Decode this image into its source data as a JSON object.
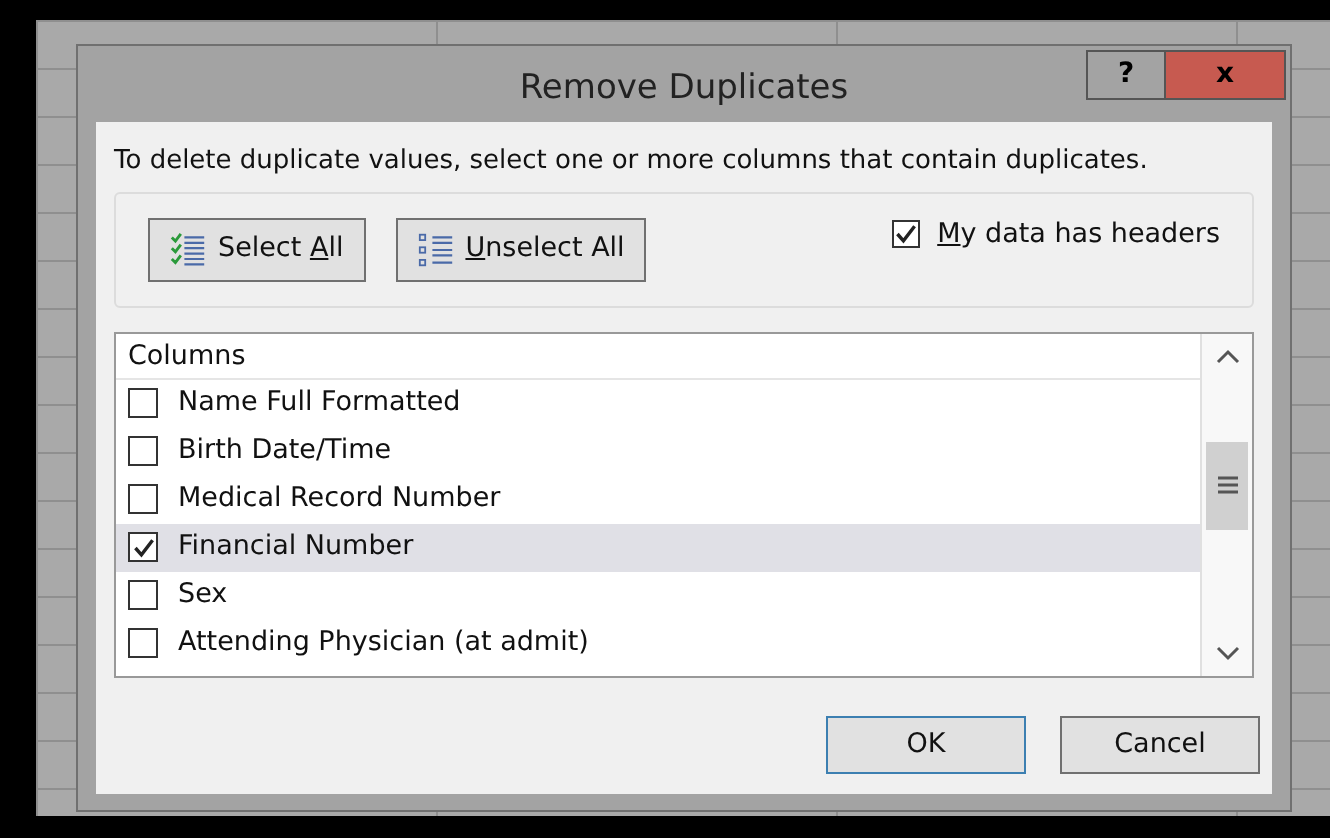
{
  "dialog": {
    "title": "Remove Duplicates",
    "help": "?",
    "close": "x",
    "instruction": "To delete duplicate values, select one or more columns that contain duplicates.",
    "buttons": [
      {
        "kind": "select",
        "label": {
          "before": "Select ",
          "accel": "A",
          "after": "ll"
        }
      },
      {
        "kind": "unselect",
        "label": {
          "accel": "U",
          "after": "nselect All"
        }
      }
    ],
    "headers_option": {
      "label": {
        "accel": "M",
        "after": "y data has headers"
      },
      "checked": true
    },
    "list": {
      "header": "Columns",
      "items": [
        {
          "label": "Name Full Formatted",
          "checked": false,
          "selected": false
        },
        {
          "label": "Birth Date/Time",
          "checked": false,
          "selected": false
        },
        {
          "label": "Medical Record Number",
          "checked": false,
          "selected": false
        },
        {
          "label": "Financial Number",
          "checked": true,
          "selected": true
        },
        {
          "label": "Sex",
          "checked": false,
          "selected": false
        },
        {
          "label": "Attending Physician (at admit)",
          "checked": false,
          "selected": false
        }
      ]
    },
    "footer": [
      {
        "kind": "default",
        "label": "OK"
      },
      {
        "kind": "normal",
        "label": "Cancel"
      }
    ]
  }
}
